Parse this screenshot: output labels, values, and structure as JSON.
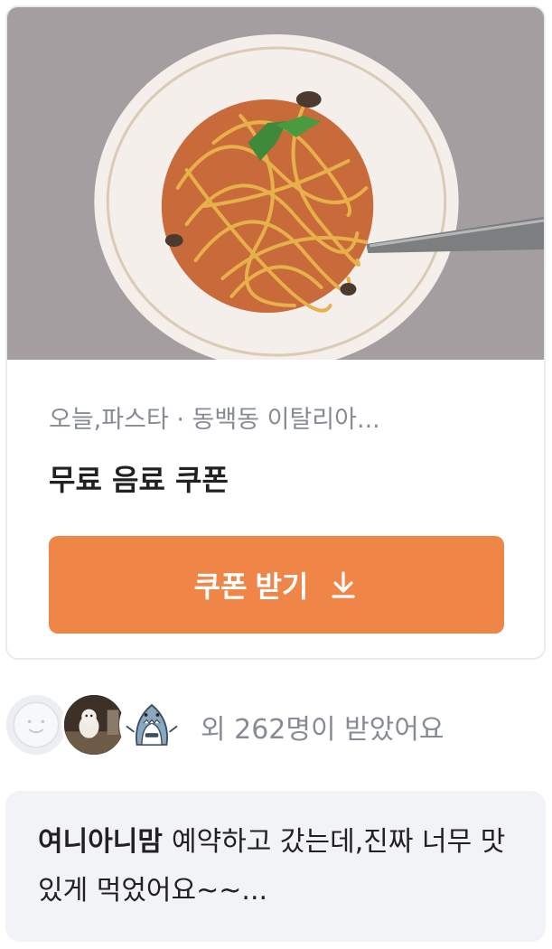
{
  "coupon": {
    "photo": "pasta-dish-photo",
    "store_line": "오늘,파스타 · 동백동 이탈리아...",
    "title": "무료 음료 쿠폰",
    "button_label": "쿠폰 받기",
    "button_icon": "download-icon",
    "accent_color": "#ef8547"
  },
  "receivers": {
    "text": "외 262명이 받았어요",
    "avatars": [
      "default-avatar",
      "dog-avatar",
      "shark-avatar"
    ]
  },
  "review": {
    "author": "여니아니맘",
    "text": "예약하고 갔는데,진짜 너무 맛있게 먹었어요~~..."
  }
}
